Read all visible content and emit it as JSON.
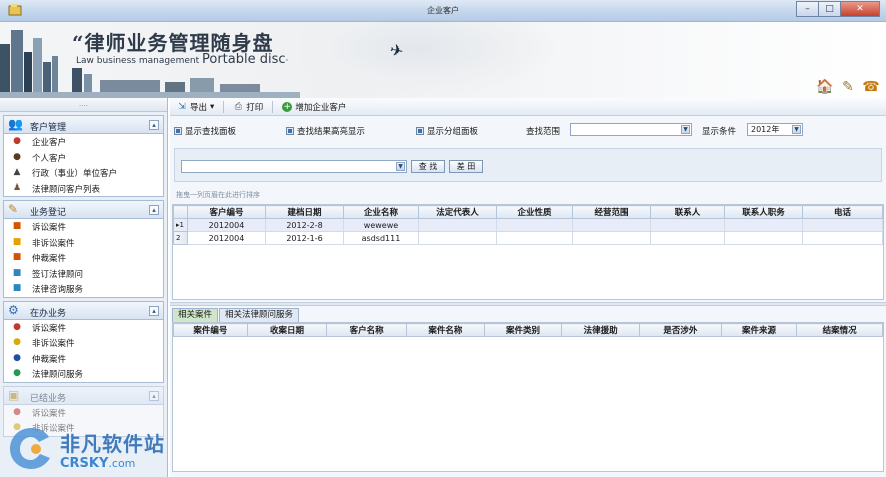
{
  "window": {
    "title": "企业客户"
  },
  "banner": {
    "title": "“律师业务管理随身盘",
    "subtitle_small": "Law business management ",
    "subtitle_big": "Portable disc",
    "subtitle_tail": "·"
  },
  "topicons": [
    {
      "name": "home-icon",
      "glyph": "🏠"
    },
    {
      "name": "tools-icon",
      "glyph": "✎"
    },
    {
      "name": "exit-icon",
      "glyph": "☎"
    }
  ],
  "sidebar": {
    "groups": [
      {
        "title": "客户管理",
        "icon": "users-icon",
        "toggle": "▴",
        "items": [
          {
            "label": "企业客户",
            "icon": "enterprise-client-icon",
            "color": "#c0392b"
          },
          {
            "label": "个人客户",
            "icon": "personal-client-icon",
            "color": "#5a3b1e"
          },
          {
            "label": "行政（事业）单位客户",
            "icon": "admin-unit-icon",
            "color": "#444"
          },
          {
            "label": "法律顾问客户列表",
            "icon": "client-list-icon",
            "color": "#7a5230"
          }
        ]
      },
      {
        "title": "业务登记",
        "icon": "register-icon",
        "toggle": "▴",
        "items": [
          {
            "label": "诉讼案件",
            "icon": "litigation-icon",
            "color": "#d35400"
          },
          {
            "label": "非诉讼案件",
            "icon": "non-litigation-icon",
            "color": "#e6a100"
          },
          {
            "label": "仲裁案件",
            "icon": "arbitration-icon",
            "color": "#d35400"
          },
          {
            "label": "签订法律顾问",
            "icon": "sign-counsel-icon",
            "color": "#2e86c1"
          },
          {
            "label": "法律咨询服务",
            "icon": "consult-icon",
            "color": "#2e86c1"
          }
        ]
      },
      {
        "title": "在办业务",
        "icon": "in-progress-icon",
        "toggle": "▴",
        "items": [
          {
            "label": "诉讼案件",
            "icon": "red-dot-icon",
            "color": "#c0392b"
          },
          {
            "label": "非诉讼案件",
            "icon": "yellow-dot-icon",
            "color": "#d4ac0d"
          },
          {
            "label": "仲裁案件",
            "icon": "blue-dot-icon",
            "color": "#1f4fa3"
          },
          {
            "label": "法律顾问服务",
            "icon": "green-dot-icon",
            "color": "#229954"
          }
        ]
      },
      {
        "title": "已结业务",
        "icon": "closed-icon",
        "toggle": "▴",
        "items": [
          {
            "label": "诉讼案件",
            "icon": "closed-litigation-icon",
            "color": "#c0392b"
          },
          {
            "label": "非诉讼案件",
            "icon": "closed-non-litigation-icon",
            "color": "#d4ac0d"
          }
        ]
      }
    ]
  },
  "toolbar": {
    "export_label": "导出",
    "export_caret": "▾",
    "print_label": "打印",
    "add_label": "增加企业客户"
  },
  "options": {
    "show_search_panel": "显示查找面板",
    "highlight_results": "查找结果高亮显示",
    "show_group_panel": "显示分组面板",
    "search_scope_label": "查找范围",
    "search_scope_value": "",
    "display_condition_label": "显示条件",
    "display_condition_value": "2012年"
  },
  "search": {
    "input_value": "",
    "find_label": "查 找",
    "clear_label": "差 田"
  },
  "group_hint": "拖曳一列页眉在此进行排序",
  "clients_table": {
    "columns": [
      "客户编号",
      "建档日期",
      "企业名称",
      "法定代表人",
      "企业性质",
      "经营范围",
      "联系人",
      "联系人职务",
      "电话"
    ],
    "rows": [
      {
        "rowhead": "▸1",
        "cells": [
          "2012004",
          "2012-2-8",
          "wewewe",
          "",
          "",
          "",
          "",
          "",
          ""
        ]
      },
      {
        "rowhead": "2",
        "cells": [
          "2012004",
          "2012-1-6",
          "asdsd111",
          "",
          "",
          "",
          "",
          "",
          ""
        ]
      }
    ]
  },
  "tabs": [
    {
      "label": "相关案件",
      "active": true
    },
    {
      "label": "相关法律顾问服务",
      "active": false
    }
  ],
  "cases_table": {
    "columns": [
      "案件编号",
      "收案日期",
      "客户名称",
      "案件名称",
      "案件类别",
      "法律援助",
      "是否涉外",
      "案件来源",
      "结案情况"
    ]
  },
  "watermark": {
    "cn": "非凡软件站",
    "en": "CRSKY",
    "domain": ".com"
  }
}
